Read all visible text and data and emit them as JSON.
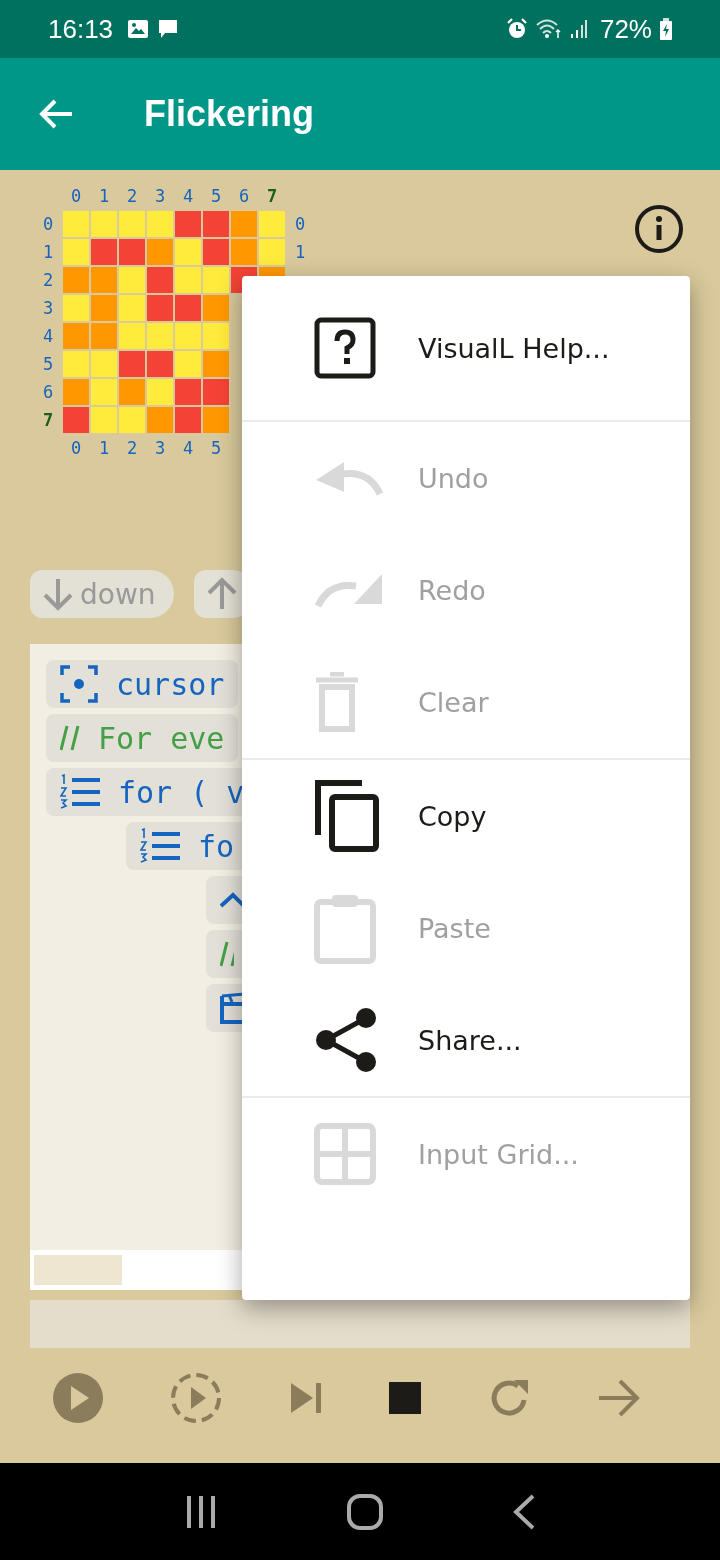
{
  "status_bar": {
    "time": "16:13",
    "battery": "72%"
  },
  "app_bar": {
    "title": "Flickering"
  },
  "grid": {
    "top_labels": [
      {
        "text": "0",
        "highlighted": false
      },
      {
        "text": "1",
        "highlighted": false
      },
      {
        "text": "2",
        "highlighted": false
      },
      {
        "text": "3",
        "highlighted": false
      },
      {
        "text": "4",
        "highlighted": false
      },
      {
        "text": "5",
        "highlighted": false
      },
      {
        "text": "6",
        "highlighted": false
      },
      {
        "text": "7",
        "highlighted": true
      }
    ],
    "rows": [
      {
        "label": "0",
        "highlighted": false,
        "right_label": "0",
        "cells": [
          {
            "color": "#ffeb3b"
          },
          {
            "color": "#ffeb3b"
          },
          {
            "color": "#ffeb3b"
          },
          {
            "color": "#ffeb3b"
          },
          {
            "color": "#f44336"
          },
          {
            "color": "#f44336"
          },
          {
            "color": "#ff9800"
          },
          {
            "color": "#ffeb3b"
          }
        ]
      },
      {
        "label": "1",
        "highlighted": false,
        "right_label": "1",
        "cells": [
          {
            "color": "#ffeb3b"
          },
          {
            "color": "#f44336"
          },
          {
            "color": "#f44336"
          },
          {
            "color": "#ff9800"
          },
          {
            "color": "#ffeb3b"
          },
          {
            "color": "#f44336"
          },
          {
            "color": "#ff9800"
          },
          {
            "color": "#ffeb3b"
          }
        ]
      },
      {
        "label": "2",
        "highlighted": false,
        "cells": [
          {
            "color": "#ff9800"
          },
          {
            "color": "#ff9800"
          },
          {
            "color": "#ffeb3b"
          },
          {
            "color": "#f44336"
          },
          {
            "color": "#ffeb3b"
          },
          {
            "color": "#ffeb3b"
          },
          {
            "color": "#f44336"
          },
          {
            "color": "#ff9800"
          }
        ]
      },
      {
        "label": "3",
        "highlighted": false,
        "cells": [
          {
            "color": "#ffeb3b"
          },
          {
            "color": "#ff9800"
          },
          {
            "color": "#ffeb3b"
          },
          {
            "color": "#f44336"
          },
          {
            "color": "#f44336"
          },
          {
            "color": "#ff9800"
          }
        ]
      },
      {
        "label": "4",
        "highlighted": false,
        "cells": [
          {
            "color": "#ff9800"
          },
          {
            "color": "#ff9800"
          },
          {
            "color": "#ffeb3b"
          },
          {
            "color": "#ffeb3b"
          },
          {
            "color": "#ffeb3b"
          },
          {
            "color": "#ffeb3b"
          }
        ]
      },
      {
        "label": "5",
        "highlighted": false,
        "cells": [
          {
            "color": "#ffeb3b"
          },
          {
            "color": "#ffeb3b"
          },
          {
            "color": "#f44336"
          },
          {
            "color": "#f44336"
          },
          {
            "color": "#ffeb3b"
          },
          {
            "color": "#ff9800"
          }
        ]
      },
      {
        "label": "6",
        "highlighted": false,
        "cells": [
          {
            "color": "#ff9800"
          },
          {
            "color": "#ffeb3b"
          },
          {
            "color": "#ff9800"
          },
          {
            "color": "#ffeb3b"
          },
          {
            "color": "#f44336"
          },
          {
            "color": "#f44336"
          }
        ]
      },
      {
        "label": "7",
        "highlighted": true,
        "cells": [
          {
            "color": "#f44336"
          },
          {
            "color": "#ffeb3b"
          },
          {
            "color": "#ffeb3b"
          },
          {
            "color": "#ff9800"
          },
          {
            "color": "#f44336"
          },
          {
            "color": "#ff9800"
          }
        ]
      }
    ],
    "bottom_labels": [
      "0",
      "1",
      "2",
      "3",
      "4",
      "5"
    ]
  },
  "direction_buttons": [
    {
      "kind": "down",
      "label": "down"
    },
    {
      "kind": "up"
    }
  ],
  "code_lines": [
    {
      "kind": "cursor",
      "text": "cursor"
    },
    {
      "kind": "comment",
      "text": "For eve"
    },
    {
      "kind": "for",
      "text": "for",
      "paren": "( v",
      "children": [
        {
          "kind": "for",
          "text": "fo",
          "children": [
            {
              "kind": "caret"
            },
            {
              "kind": "comment"
            },
            {
              "kind": "clapper"
            }
          ]
        }
      ]
    }
  ],
  "menu": {
    "items": [
      {
        "kind": "help",
        "label": "VisualL Help...",
        "disabled": false,
        "divider_after": true
      },
      {
        "kind": "undo",
        "label": "Undo",
        "disabled": true,
        "divider_after": false
      },
      {
        "kind": "redo",
        "label": "Redo",
        "disabled": true,
        "divider_after": false
      },
      {
        "kind": "clear",
        "label": "Clear",
        "disabled": true,
        "divider_after": true
      },
      {
        "kind": "copy",
        "label": "Copy",
        "disabled": false,
        "divider_after": false
      },
      {
        "kind": "paste",
        "label": "Paste",
        "disabled": true,
        "divider_after": false
      },
      {
        "kind": "share",
        "label": "Share...",
        "disabled": false,
        "divider_after": true
      },
      {
        "kind": "grid",
        "label": "Input Grid...",
        "disabled": true,
        "divider_after": false
      }
    ]
  }
}
